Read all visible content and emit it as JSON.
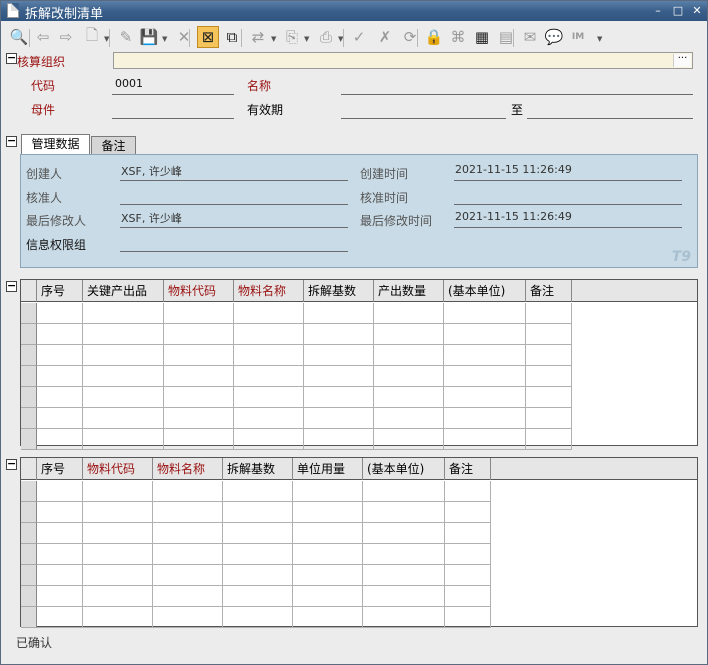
{
  "window": {
    "title": "拆解改制清单",
    "controls": [
      "–",
      "□",
      "✕"
    ]
  },
  "toolbar": {
    "buttons": [
      {
        "icon": "preview-search-icon",
        "glyph": "🔍",
        "enabled": true
      },
      {
        "icon": "arrow-left-icon",
        "glyph": "⇦",
        "enabled": false
      },
      {
        "icon": "arrow-right-icon",
        "glyph": "⇨",
        "enabled": false
      },
      {
        "icon": "new-document-icon",
        "glyph": "🗋",
        "enabled": false
      },
      {
        "icon": "edit-icon",
        "glyph": "✎",
        "enabled": false
      },
      {
        "icon": "save-icon",
        "glyph": "💾",
        "enabled": true
      },
      {
        "icon": "delete-icon",
        "glyph": "✕",
        "enabled": false
      },
      {
        "icon": "void-document-icon",
        "glyph": "⊠",
        "enabled": true,
        "selected": true
      },
      {
        "icon": "copy-icon",
        "glyph": "⧉",
        "enabled": true
      },
      {
        "icon": "link-icon",
        "glyph": "⇄",
        "enabled": false
      },
      {
        "icon": "import-icon",
        "glyph": "⎘",
        "enabled": false
      },
      {
        "icon": "print-icon",
        "glyph": "⎙",
        "enabled": false
      },
      {
        "icon": "audit-icon",
        "glyph": "✓",
        "enabled": false
      },
      {
        "icon": "unaudit-icon",
        "glyph": "✗",
        "enabled": false
      },
      {
        "icon": "refresh-icon",
        "glyph": "⟳",
        "enabled": false
      },
      {
        "icon": "lock-icon",
        "glyph": "🔒",
        "enabled": false
      },
      {
        "icon": "attachment-icon",
        "glyph": "⌘",
        "enabled": false
      },
      {
        "icon": "calculator-icon",
        "glyph": "▦",
        "enabled": true
      },
      {
        "icon": "document-icon",
        "glyph": "▤",
        "enabled": false
      },
      {
        "icon": "mail-icon",
        "glyph": "✉",
        "enabled": false
      },
      {
        "icon": "message-icon",
        "glyph": "💬",
        "enabled": false
      },
      {
        "icon": "im-icon",
        "glyph": "IM",
        "enabled": false
      }
    ]
  },
  "header": {
    "org_label": "核算组织",
    "org_value": "",
    "org_button": "···",
    "code_label": "代码",
    "code_value": "0001",
    "name_label": "名称",
    "name_value": "",
    "parent_label": "母件",
    "parent_value": "",
    "valid_label": "有效期",
    "valid_from": "",
    "to_label": "至",
    "valid_to": ""
  },
  "tabs": [
    {
      "label": "管理数据",
      "active": true
    },
    {
      "label": "备注",
      "active": false
    }
  ],
  "management": {
    "creator_label": "创建人",
    "creator_value": "XSF, 许少峰",
    "create_time_label": "创建时间",
    "create_time_value": "2021-11-15 11:26:49",
    "approver_label": "核准人",
    "approver_value": "",
    "approve_time_label": "核准时间",
    "approve_time_value": "",
    "modifier_label": "最后修改人",
    "modifier_value": "XSF, 许少峰",
    "modify_time_label": "最后修改时间",
    "modify_time_value": "2021-11-15 11:26:49",
    "perm_label": "信息权限组",
    "perm_value": "",
    "logo": "T9"
  },
  "grid1": {
    "columns": [
      {
        "label": "序号",
        "required": false
      },
      {
        "label": "关键产出品",
        "required": false
      },
      {
        "label": "物料代码",
        "required": true
      },
      {
        "label": "物料名称",
        "required": true
      },
      {
        "label": "拆解基数",
        "required": false
      },
      {
        "label": "产出数量",
        "required": false
      },
      {
        "label": "(基本单位)",
        "required": false
      },
      {
        "label": "备注",
        "required": false
      }
    ],
    "row_count": 7
  },
  "grid2": {
    "columns": [
      {
        "label": "序号",
        "required": false
      },
      {
        "label": "物料代码",
        "required": true
      },
      {
        "label": "物料名称",
        "required": true
      },
      {
        "label": "拆解基数",
        "required": false
      },
      {
        "label": "单位用量",
        "required": false
      },
      {
        "label": "(基本单位)",
        "required": false
      },
      {
        "label": "备注",
        "required": false
      }
    ],
    "row_count": 7
  },
  "status": {
    "text": "已确认"
  },
  "colors": {
    "title_bar": "#3a5f8a",
    "required_label": "#9a1010",
    "panel_bg": "#c9dbe6",
    "org_field_bg": "#f7f3dc",
    "selected_tool": "#f5c55c"
  }
}
